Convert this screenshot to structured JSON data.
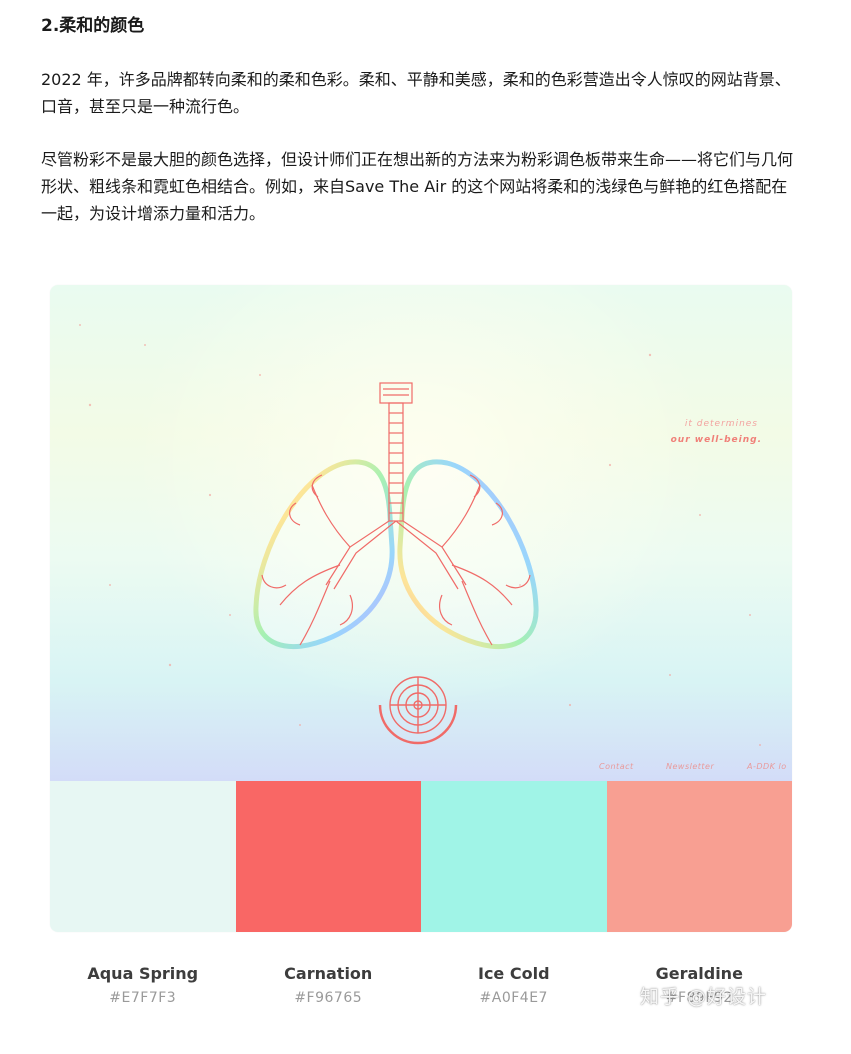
{
  "article": {
    "heading": "2.柔和的颜色",
    "paragraph_1": "2022 年，许多品牌都转向柔和的柔和色彩。柔和、平静和美感，柔和的色彩营造出令人惊叹的网站背景、口音，甚至只是一种流行色。",
    "paragraph_2": "尽管粉彩不是最大胆的颜色选择，但设计师们正在想出新的方法来为粉彩调色板带来生命——将它们与几何形状、粗线条和霓虹色相结合。例如，来自Save The Air 的这个网站将柔和的浅绿色与鲜艳的红色搭配在一起，为设计增添力量和活力。"
  },
  "hero": {
    "tagline_line1": "it determines",
    "tagline_line2": "our well-being.",
    "nav": [
      "Contact",
      "Newsletter",
      "A-DDK lo"
    ],
    "accent_color": "#F08079",
    "illustration": "lungs-illustration"
  },
  "palette": [
    {
      "name": "Aqua Spring",
      "hex": "#E7F7F3"
    },
    {
      "name": "Carnation",
      "hex": "#F96765"
    },
    {
      "name": "Ice Cold",
      "hex": "#A0F4E7"
    },
    {
      "name": "Geraldine",
      "hex": "#F89F92"
    }
  ],
  "watermark": "知乎 @好设计"
}
